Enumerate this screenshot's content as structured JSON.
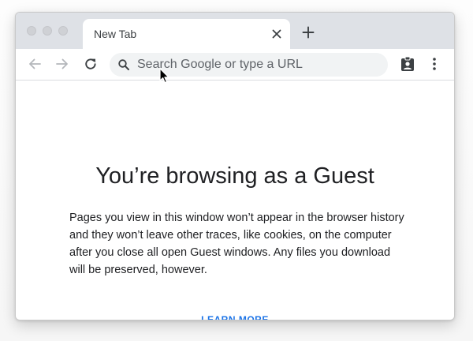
{
  "browser": {
    "tab": {
      "title": "New Tab",
      "close_icon": "close-icon"
    },
    "new_tab_icon": "plus-icon",
    "toolbar": {
      "back_icon": "arrow-left-icon",
      "forward_icon": "arrow-right-icon",
      "reload_icon": "reload-icon",
      "omnibox": {
        "placeholder": "Search Google or type a URL",
        "value": "",
        "search_icon": "search-icon"
      },
      "profile_icon": "guest-profile-icon",
      "menu_icon": "more-vert-icon"
    }
  },
  "page": {
    "title": "You’re browsing as a Guest",
    "description": "Pages you view in this window won’t appear in the browser history and they won’t leave other traces, like cookies, on the computer after you close all open Guest windows. Any files you download will be preserved, however.",
    "learn_more": "LEARN MORE"
  },
  "colors": {
    "tabstrip": "#dee1e6",
    "omnibox": "#f1f3f4",
    "text": "#202124",
    "link": "#1a73e8"
  }
}
